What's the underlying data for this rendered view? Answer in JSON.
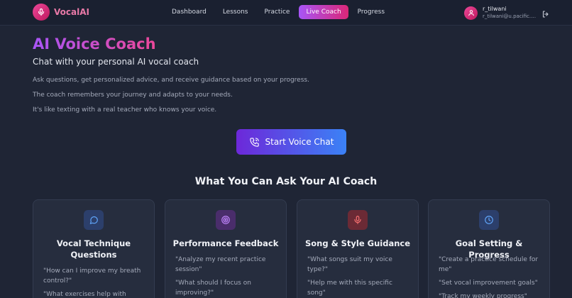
{
  "app": {
    "name": "VocalAI"
  },
  "nav": {
    "links": [
      {
        "label": "Dashboard"
      },
      {
        "label": "Lessons"
      },
      {
        "label": "Practice"
      },
      {
        "label": "Live Coach"
      },
      {
        "label": "Progress"
      }
    ],
    "active": "Live Coach"
  },
  "user": {
    "name": "r_tilwani",
    "email": "r_tilwani@u.pacific.edu"
  },
  "hero": {
    "title": "AI Voice Coach",
    "subtitle": "Chat with your personal AI vocal coach",
    "paragraphs": [
      "Ask questions, get personalized advice, and receive guidance based on your progress.",
      "The coach remembers your journey and adapts to your needs.",
      "It's like texting with a real teacher who knows your voice."
    ],
    "start_button": "Start Voice Chat"
  },
  "section": {
    "title": "What You Can Ask Your AI Coach"
  },
  "cards": [
    {
      "icon": "chat-bubble-icon",
      "color": "#3b82f6",
      "title": "Vocal Technique Questions",
      "examples": [
        "\"How can I improve my breath control?\"",
        "\"What exercises help with"
      ]
    },
    {
      "icon": "target-icon",
      "color": "#a855f7",
      "title": "Performance Feedback",
      "examples": [
        "\"Analyze my recent practice session\"",
        "\"What should I focus on improving?\""
      ]
    },
    {
      "icon": "microphone-icon",
      "color": "#ef4444",
      "title": "Song & Style Guidance",
      "examples": [
        "\"What songs suit my voice type?\"",
        "\"Help me with this specific song\""
      ]
    },
    {
      "icon": "clock-icon",
      "color": "#3b82f6",
      "title": "Goal Setting & Progress",
      "examples": [
        "\"Create a practice schedule for me\"",
        "\"Set vocal improvement goals\"",
        "\"Track my weekly progress\""
      ]
    }
  ],
  "colors": {
    "accent_pink": "#ec4899",
    "accent_purple": "#a855f7",
    "accent_blue": "#3b82f6",
    "background": "#1f2535"
  }
}
